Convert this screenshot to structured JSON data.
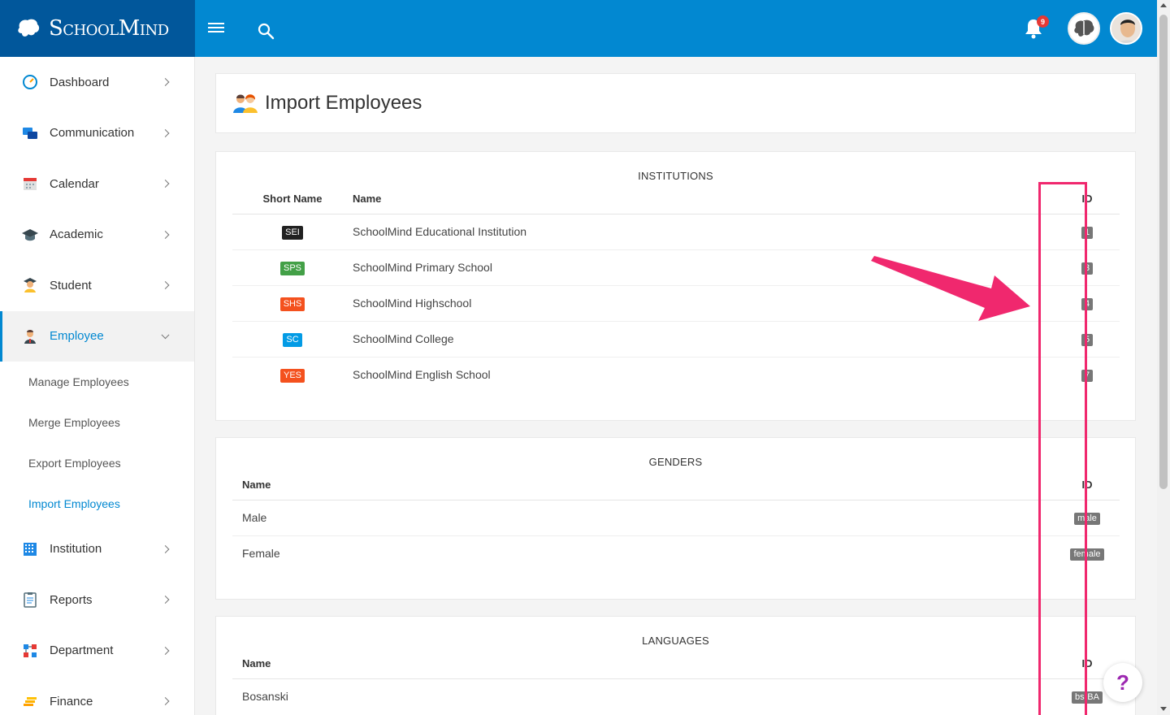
{
  "brand": {
    "name": "SchoolMind"
  },
  "header": {
    "notification_count": "9"
  },
  "sidebar": {
    "items": [
      {
        "label": "Dashboard",
        "icon": "dashboard-gauge-icon"
      },
      {
        "label": "Communication",
        "icon": "chat-bubbles-icon"
      },
      {
        "label": "Calendar",
        "icon": "calendar-icon"
      },
      {
        "label": "Academic",
        "icon": "graduation-cap-icon"
      },
      {
        "label": "Student",
        "icon": "student-icon"
      },
      {
        "label": "Employee",
        "icon": "employee-icon"
      },
      {
        "label": "Institution",
        "icon": "building-grid-icon"
      },
      {
        "label": "Reports",
        "icon": "clipboard-icon"
      },
      {
        "label": "Department",
        "icon": "department-nodes-icon"
      },
      {
        "label": "Finance",
        "icon": "coins-icon"
      }
    ],
    "employee_sub": [
      {
        "label": "Manage Employees"
      },
      {
        "label": "Merge Employees"
      },
      {
        "label": "Export Employees"
      },
      {
        "label": "Import Employees"
      }
    ]
  },
  "page": {
    "title": "Import Employees"
  },
  "institutions": {
    "title": "INSTITUTIONS",
    "headers": {
      "short": "Short Name",
      "name": "Name",
      "id": "ID"
    },
    "rows": [
      {
        "short": "SEI",
        "color": "#212121",
        "name": "SchoolMind Educational Institution",
        "id": "1"
      },
      {
        "short": "SPS",
        "color": "#43a047",
        "name": "SchoolMind Primary School",
        "id": "3"
      },
      {
        "short": "SHS",
        "color": "#f4511e",
        "name": "SchoolMind Highschool",
        "id": "4"
      },
      {
        "short": "SC",
        "color": "#039be5",
        "name": "SchoolMind College",
        "id": "5"
      },
      {
        "short": "YES",
        "color": "#f4511e",
        "name": "SchoolMind English School",
        "id": "7"
      }
    ]
  },
  "genders": {
    "title": "GENDERS",
    "headers": {
      "name": "Name",
      "id": "ID"
    },
    "rows": [
      {
        "name": "Male",
        "id": "male"
      },
      {
        "name": "Female",
        "id": "female"
      }
    ]
  },
  "languages": {
    "title": "LANGUAGES",
    "headers": {
      "name": "Name",
      "id": "ID"
    },
    "rows": [
      {
        "name": "Bosanski",
        "id": "bs-BA"
      }
    ]
  },
  "help": {
    "label": "?"
  },
  "colors": {
    "primary": "#0288d1",
    "brand_dark": "#01579b",
    "highlight": "#f0286e"
  }
}
